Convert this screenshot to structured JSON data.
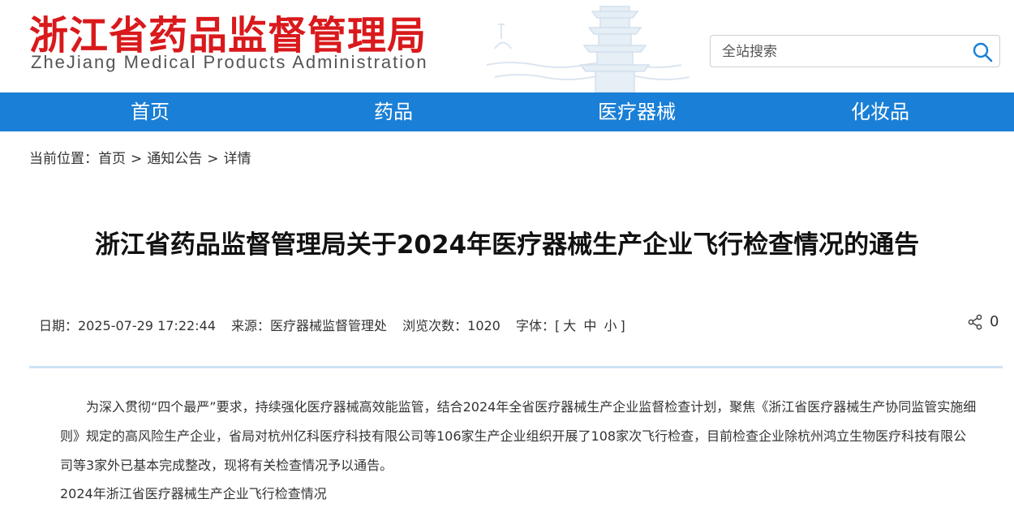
{
  "header": {
    "logo_cn": "浙江省药品监督管理局",
    "logo_en": "ZheJiang Medical Products Administration",
    "search_placeholder": "全站搜索"
  },
  "nav": {
    "items": [
      "首页",
      "药品",
      "医疗器械",
      "化妆品"
    ]
  },
  "breadcrumb": {
    "label": "当前位置：",
    "items": [
      "首页",
      "通知公告",
      "详情"
    ],
    "separator": ">"
  },
  "article": {
    "title": "浙江省药品监督管理局关于2024年医疗器械生产企业飞行检查情况的通告",
    "meta": {
      "date": "日期：2025-07-29 17:22:44",
      "source": "来源：医疗器械监督管理处",
      "views": "浏览次数：1020",
      "font_label": "字体：[",
      "font_large": "大",
      "font_medium": "中",
      "font_small": "小",
      "font_close": "]"
    },
    "share_count": "0",
    "body": "为深入贯彻“四个最严”要求，持续强化医疗器械高效能监管，结合2024年全省医疗器械生产企业监督检查计划，聚焦《浙江省医疗器械生产协同监管实施细则》规定的高风险生产企业，省局对杭州亿科医疗科技有限公司等106家生产企业组织开展了108家次飞行检查，目前检查企业除杭州鸿立生物医疗科技有限公司等3家外已基本完成整改，现将有关检查情况予以通告。",
    "subheading": "2024年浙江省医疗器械生产企业飞行检查情况"
  },
  "colors": {
    "brand_red": "#d9191c",
    "nav_blue": "#1a7fd6",
    "search_icon_blue": "#1a7fd6",
    "divider": "#cfe3f5"
  }
}
